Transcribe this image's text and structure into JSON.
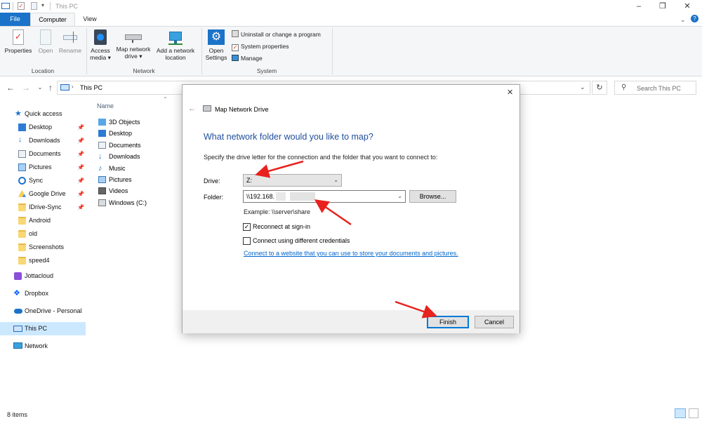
{
  "window": {
    "title": "This PC"
  },
  "ribbon": {
    "tabs": [
      "File",
      "Computer",
      "View"
    ],
    "location": {
      "label": "Location",
      "properties": "Properties",
      "open": "Open",
      "rename": "Rename"
    },
    "network": {
      "label": "Network",
      "access_media": [
        "Access",
        "media ▾"
      ],
      "map_drive": [
        "Map network",
        "drive ▾"
      ],
      "add_location": [
        "Add a network",
        "location"
      ]
    },
    "system": {
      "label": "System",
      "open_settings": [
        "Open",
        "Settings"
      ],
      "uninstall": "Uninstall or change a program",
      "sys_props": "System properties",
      "manage": "Manage"
    }
  },
  "address": {
    "path": "This PC",
    "search_placeholder": "Search This PC"
  },
  "nav": {
    "quick_access": "Quick access",
    "pinned": [
      "Desktop",
      "Downloads",
      "Documents",
      "Pictures",
      "Sync",
      "Google Drive",
      "IDrive-Sync"
    ],
    "folders": [
      "Android",
      "old",
      "Screenshots",
      "speed4"
    ],
    "jottacloud": "Jottacloud",
    "dropbox": "Dropbox",
    "onedrive": "OneDrive - Personal",
    "this_pc": "This PC",
    "network": "Network"
  },
  "content": {
    "column_name": "Name",
    "items": [
      "3D Objects",
      "Desktop",
      "Documents",
      "Downloads",
      "Music",
      "Pictures",
      "Videos",
      "Windows (C:)"
    ]
  },
  "status": {
    "count": "8 items"
  },
  "dialog": {
    "title": "Map Network Drive",
    "heading": "What network folder would you like to map?",
    "instruction": "Specify the drive letter for the connection and the folder that you want to connect to:",
    "drive_label": "Drive:",
    "drive_value": "Z:",
    "folder_label": "Folder:",
    "folder_value": "\\\\192.168.",
    "browse": "Browse...",
    "example": "Example: \\\\server\\share",
    "reconnect": "Reconnect at sign-in",
    "reconnect_checked": true,
    "diff_creds": "Connect using different credentials",
    "diff_creds_checked": false,
    "link": "Connect to a website that you can use to store your documents and pictures.",
    "finish": "Finish",
    "cancel": "Cancel"
  },
  "colors": {
    "accent": "#1a73c8",
    "heading": "#003399",
    "link": "#0066cc",
    "annotation": "#e8211d"
  }
}
